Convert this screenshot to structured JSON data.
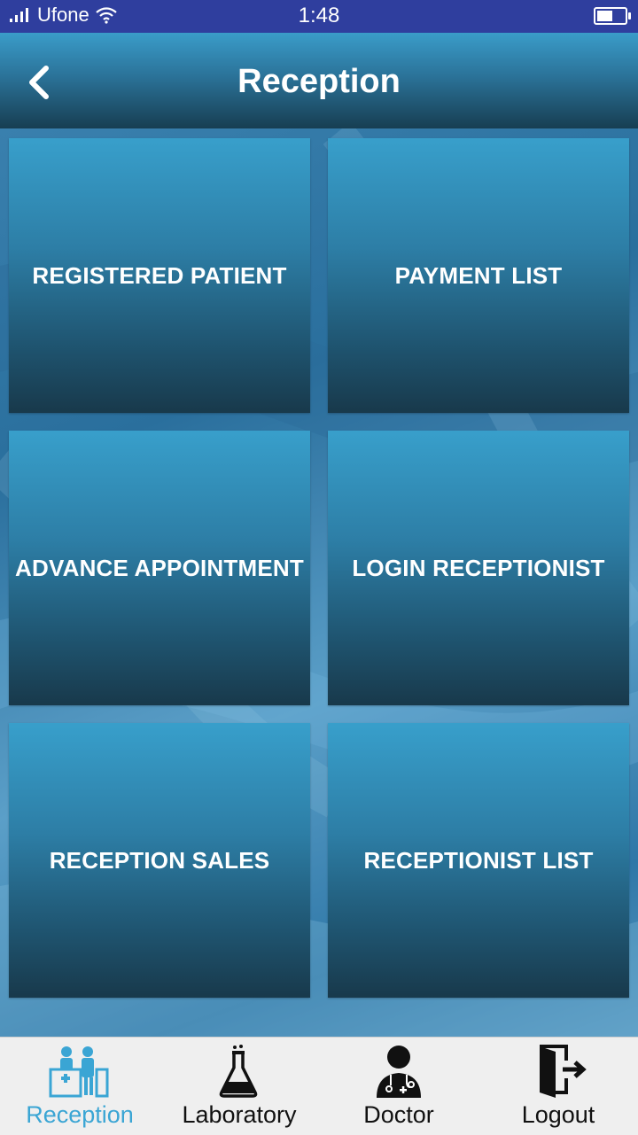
{
  "status_bar": {
    "carrier": "Ufone",
    "time": "1:48",
    "battery_level": 0.55
  },
  "app_bar": {
    "title": "Reception",
    "back_icon": "chevron-left-icon"
  },
  "tiles": [
    {
      "label": "REGISTERED PATIENT"
    },
    {
      "label": "PAYMENT LIST"
    },
    {
      "label": "ADVANCE APPOINTMENT"
    },
    {
      "label": "LOGIN RECEPTIONIST"
    },
    {
      "label": "RECEPTION SALES"
    },
    {
      "label": "RECEPTIONIST LIST"
    }
  ],
  "bottom_nav": [
    {
      "label": "Reception",
      "icon": "reception-desk-icon",
      "active": true
    },
    {
      "label": "Laboratory",
      "icon": "flask-icon",
      "active": false
    },
    {
      "label": "Doctor",
      "icon": "doctor-icon",
      "active": false
    },
    {
      "label": "Logout",
      "icon": "logout-door-icon",
      "active": false
    }
  ],
  "colors": {
    "status_bar": "#2f3e9e",
    "accent": "#3aa5d4",
    "tile_top": "#389fcb",
    "tile_bottom": "#18394b"
  }
}
